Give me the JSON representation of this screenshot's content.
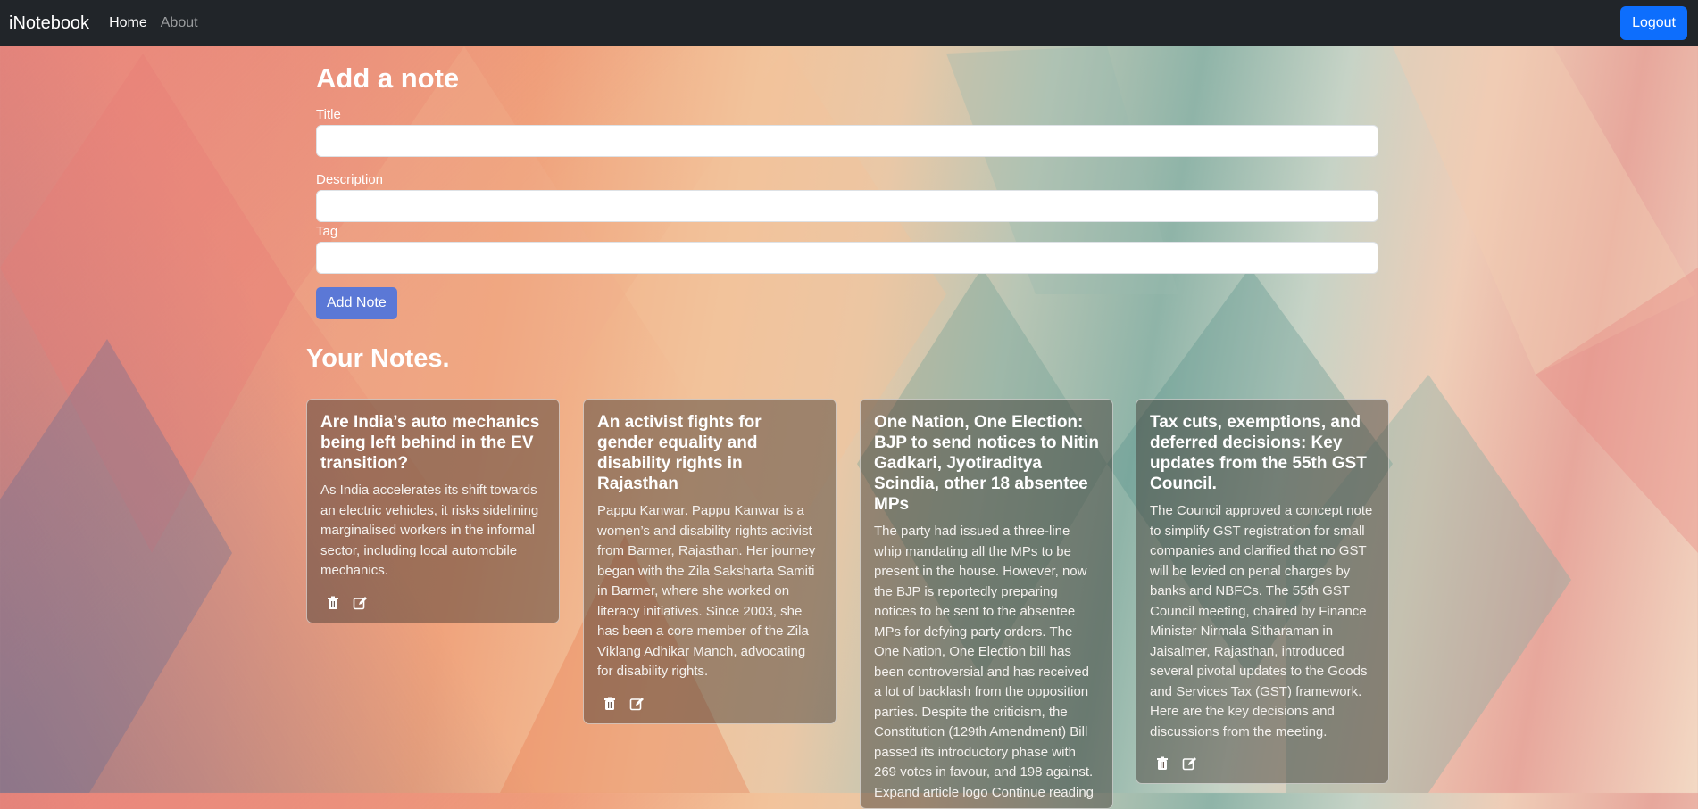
{
  "navbar": {
    "brand": "iNotebook",
    "links": [
      {
        "label": "Home"
      },
      {
        "label": "About"
      }
    ],
    "logout_label": "Logout"
  },
  "add_note": {
    "heading": "Add a note",
    "title_label": "Title",
    "description_label": "Description",
    "tag_label": "Tag",
    "title_value": "",
    "description_value": "",
    "tag_value": "",
    "submit_label": "Add Note"
  },
  "notes": {
    "heading": "Your Notes.",
    "items": [
      {
        "title": "Are India’s auto mechanics being left behind in the EV transition?",
        "description": "As India accelerates its shift towards an electric vehicles, it risks sidelining marginalised workers in the informal sector, including local automobile mechanics."
      },
      {
        "title": "An activist fights for gender equality and disability rights in Rajasthan",
        "description": "Pappu Kanwar. Pappu Kanwar is a women’s and disability rights activist from Barmer, Rajasthan. Her journey began with the Zila Saksharta Samiti in Barmer, where she worked on literacy initiatives. Since 2003, she has been a core member of the Zila Viklang Adhikar Manch, advocating for disability rights."
      },
      {
        "title": "One Nation, One Election: BJP to send notices to Nitin Gadkari, Jyotiraditya Scindia, other 18 absentee MPs",
        "description": "The party had issued a three-line whip mandating all the MPs to be present in the house. However, now the BJP is reportedly preparing notices to be sent to the absentee MPs for defying party orders. The One Nation, One Election bill has been controversial and has received a lot of backlash from the opposition parties. Despite the criticism, the Constitution (129th Amendment) Bill passed its introductory phase with 269 votes in favour, and 198 against. Expand article logo Continue reading"
      },
      {
        "title": "Tax cuts, exemptions, and deferred decisions: Key updates from the 55th GST Council.",
        "description": "The Council approved a concept note to simplify GST registration for small companies and clarified that no GST will be levied on penal charges by banks and NBFCs. The 55th GST Council meeting, chaired by Finance Minister Nirmala Sitharaman in Jaisalmer, Rajasthan, introduced several pivotal updates to the Goods and Services Tax (GST) framework. Here are the key decisions and discussions from the meeting."
      }
    ]
  },
  "icons": {
    "delete": "trash-icon",
    "edit": "edit-icon"
  }
}
